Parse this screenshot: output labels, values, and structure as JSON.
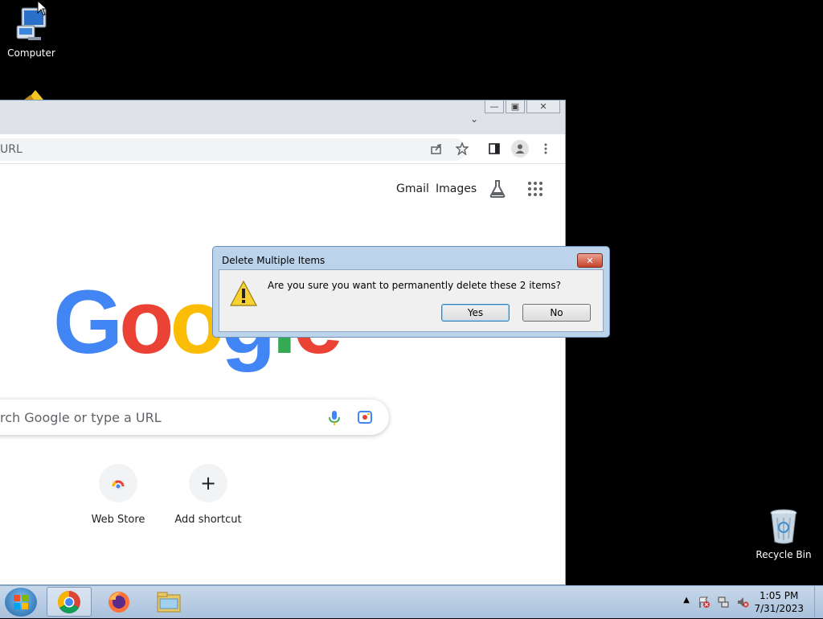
{
  "desktop": {
    "icons": [
      {
        "label": "Computer"
      },
      {
        "label": "Recycle Bin"
      }
    ]
  },
  "chrome": {
    "omnibox_text": "URL",
    "links": {
      "gmail": "Gmail",
      "images": "Images"
    },
    "logo": "Google",
    "search_placeholder": "rch Google or type a URL",
    "shortcuts": [
      {
        "label": "Web Store"
      },
      {
        "label": "Add shortcut"
      }
    ]
  },
  "dialog": {
    "title": "Delete Multiple Items",
    "message": "Are you sure you want to permanently delete these 2 items?",
    "yes_label": "Yes",
    "no_label": "No"
  },
  "taskbar": {
    "time": "1:05 PM",
    "date": "7/31/2023"
  }
}
